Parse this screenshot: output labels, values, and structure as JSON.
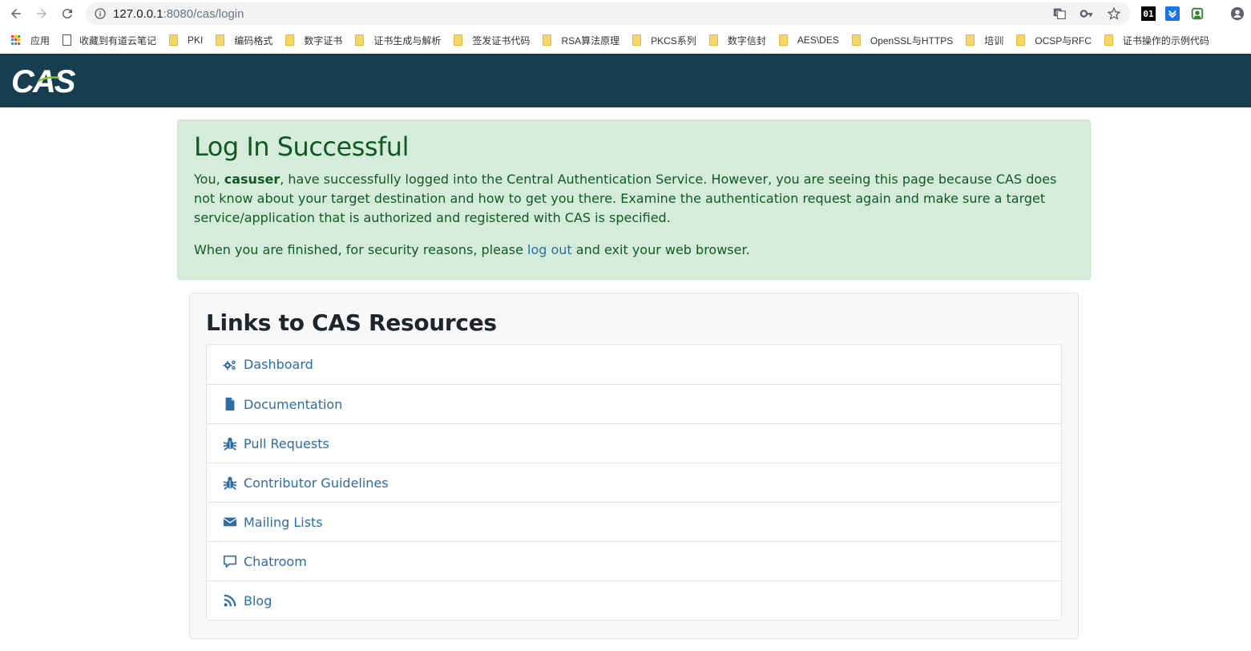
{
  "browser": {
    "url_host": "127.0.0.1",
    "url_rest": ":8080/cas/login",
    "bookmarks": [
      {
        "label": "应用",
        "kind": "apps"
      },
      {
        "label": "收藏到有道云笔记",
        "kind": "doc"
      },
      {
        "label": "PKI",
        "kind": "folder"
      },
      {
        "label": "编码格式",
        "kind": "folder"
      },
      {
        "label": "数字证书",
        "kind": "folder"
      },
      {
        "label": "证书生成与解析",
        "kind": "folder"
      },
      {
        "label": "签发证书代码",
        "kind": "folder"
      },
      {
        "label": "RSA算法原理",
        "kind": "folder"
      },
      {
        "label": "PKCS系列",
        "kind": "folder"
      },
      {
        "label": "数字信封",
        "kind": "folder"
      },
      {
        "label": "AES\\DES",
        "kind": "folder"
      },
      {
        "label": "OpenSSL与HTTPS",
        "kind": "folder"
      },
      {
        "label": "培训",
        "kind": "folder"
      },
      {
        "label": "OCSP与RFC",
        "kind": "folder"
      },
      {
        "label": "证书操作的示例代码",
        "kind": "folder"
      }
    ],
    "extension_01": "01"
  },
  "header": {
    "logo_text": "CAS",
    "bg_color": "#153e50"
  },
  "alert": {
    "title": "Log In Successful",
    "p1_before": "You, ",
    "p1_user": "casuser",
    "p1_after": ", have successfully logged into the Central Authentication Service. However, you are seeing this page because CAS does not know about your target destination and how to get you there. Examine the authentication request again and make sure a target service/application that is authorized and registered with CAS is specified.",
    "p2_before": "When you are finished, for security reasons, please ",
    "p2_link": "log out",
    "p2_after": " and exit your web browser."
  },
  "resources": {
    "title": "Links to CAS Resources",
    "items": [
      {
        "label": "Dashboard",
        "icon": "cogs-icon"
      },
      {
        "label": "Documentation",
        "icon": "file-icon"
      },
      {
        "label": "Pull Requests",
        "icon": "bug-icon"
      },
      {
        "label": "Contributor Guidelines",
        "icon": "bug-icon"
      },
      {
        "label": "Mailing Lists",
        "icon": "envelope-icon"
      },
      {
        "label": "Chatroom",
        "icon": "comment-icon"
      },
      {
        "label": "Blog",
        "icon": "rss-icon"
      }
    ]
  },
  "colors": {
    "alert_bg": "#d4eddb",
    "alert_text": "#155724",
    "link": "#2e6da4"
  }
}
